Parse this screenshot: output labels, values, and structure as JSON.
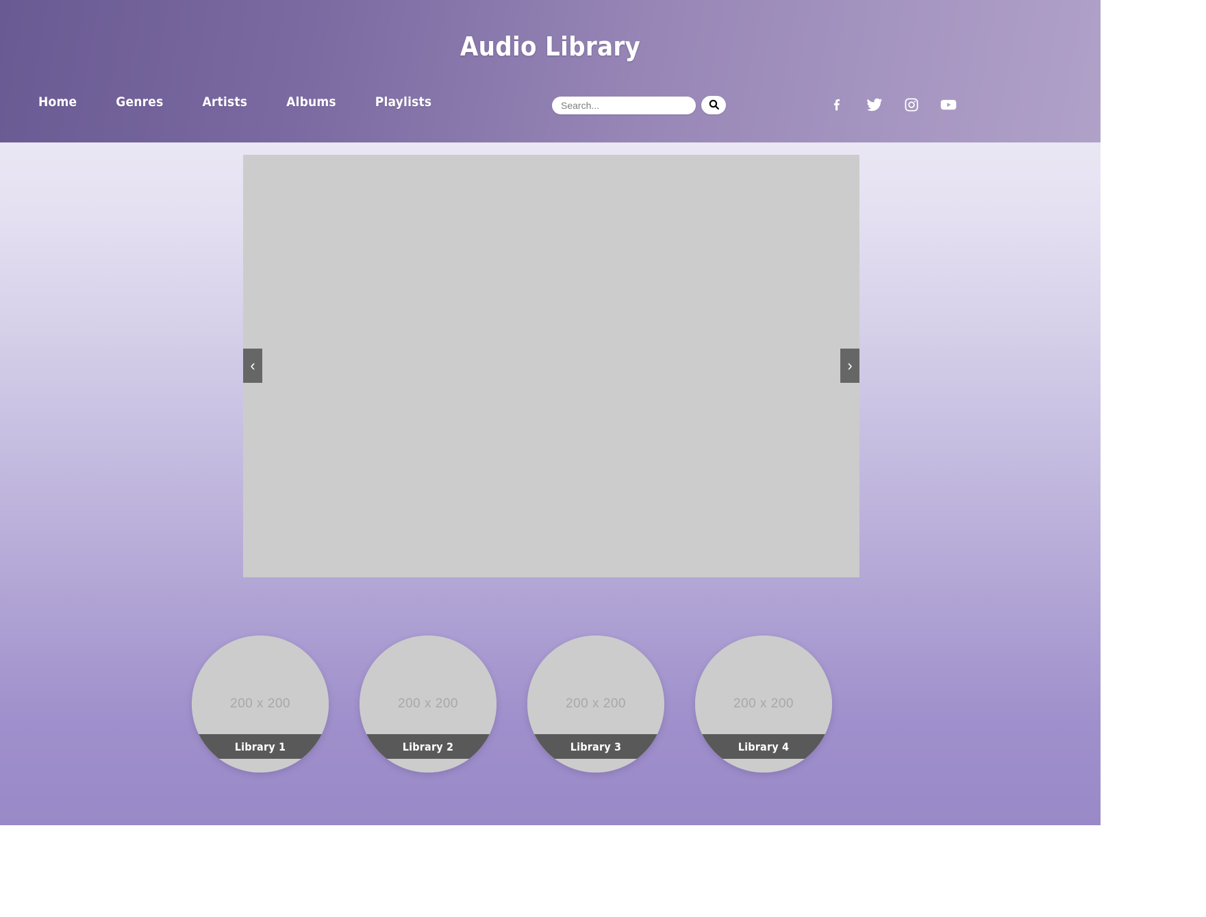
{
  "header": {
    "brand": "Audio Library",
    "nav": [
      {
        "label": "Home",
        "name": "nav-item-home"
      },
      {
        "label": "Genres",
        "name": "nav-item-genres"
      },
      {
        "label": "Artists",
        "name": "nav-item-artists"
      },
      {
        "label": "Albums",
        "name": "nav-item-albums"
      },
      {
        "label": "Playlists",
        "name": "nav-item-playlists"
      }
    ],
    "search": {
      "placeholder": "Search...",
      "value": "",
      "button_icon": "search-icon"
    },
    "social": [
      {
        "name": "facebook-icon",
        "label": "Facebook"
      },
      {
        "name": "twitter-icon",
        "label": "Twitter"
      },
      {
        "name": "instagram-icon",
        "label": "Instagram"
      },
      {
        "name": "youtube-icon",
        "label": "YouTube"
      }
    ],
    "colors": {
      "gradient_start": "#6a5a93",
      "gradient_end": "#b0a1c9",
      "text": "#ffffff"
    }
  },
  "carousel": {
    "prev_label": "‹",
    "next_label": "›",
    "slide_placeholder": "",
    "arrow_color": "#666666",
    "slide_color": "#cccccc"
  },
  "thumbnails": [
    {
      "placeholder": "200 x 200",
      "caption": "Library 1"
    },
    {
      "placeholder": "200 x 200",
      "caption": "Library 2"
    },
    {
      "placeholder": "200 x 200",
      "caption": "Library 3"
    },
    {
      "placeholder": "200 x 200",
      "caption": "Library 4"
    }
  ],
  "page": {
    "background_top": "#eae7f4",
    "background_bottom": "#9a89c8",
    "canvas": "#ffffff"
  }
}
